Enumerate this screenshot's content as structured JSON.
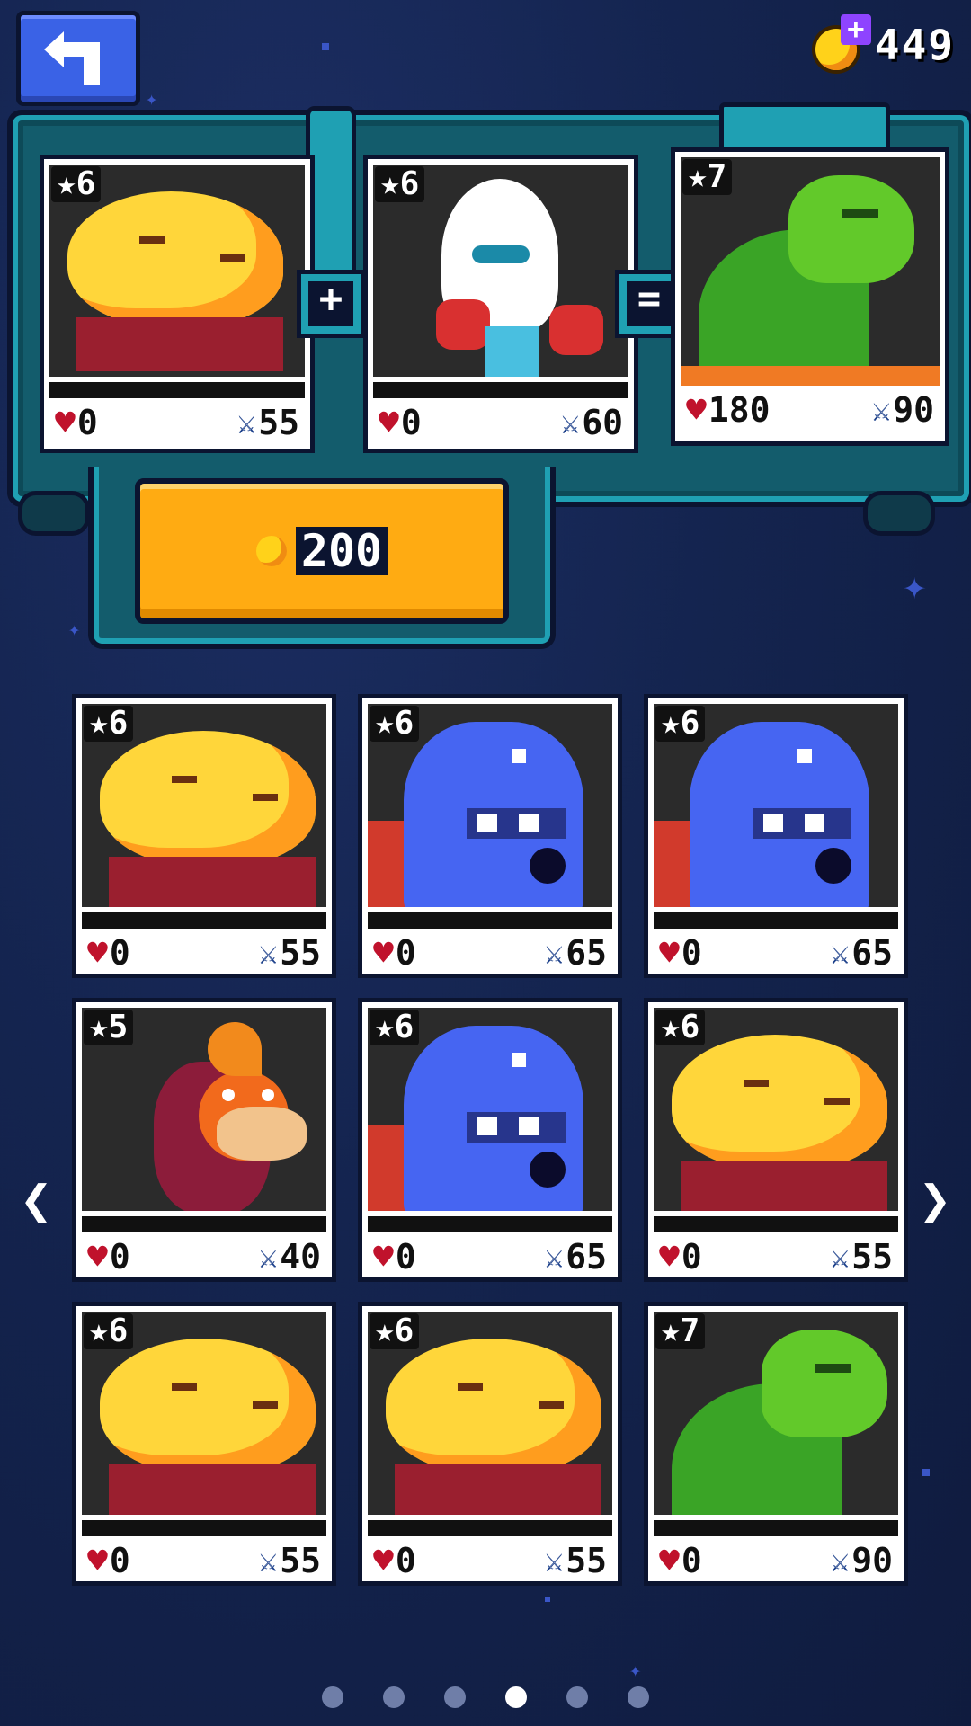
{
  "currency": {
    "value": "449",
    "icon": "gem-coin-plus-icon"
  },
  "fusion": {
    "slot1": {
      "stars": "★6",
      "hp": "0",
      "atk": "55",
      "creature": "sun-crab"
    },
    "slot2": {
      "stars": "★6",
      "hp": "0",
      "atk": "60",
      "creature": "boxer-ghost"
    },
    "result": {
      "stars": "★7",
      "hp": "180",
      "atk": "90",
      "creature": "green-dragon"
    },
    "plus_sign": "+",
    "equals_sign": "=",
    "cost": "200"
  },
  "grid": [
    {
      "stars": "★6",
      "hp": "0",
      "atk": "55",
      "creature": "sun-crab"
    },
    {
      "stars": "★6",
      "hp": "0",
      "atk": "65",
      "creature": "blue-beast"
    },
    {
      "stars": "★6",
      "hp": "0",
      "atk": "65",
      "creature": "blue-beast"
    },
    {
      "stars": "★5",
      "hp": "0",
      "atk": "40",
      "creature": "fire-duck"
    },
    {
      "stars": "★6",
      "hp": "0",
      "atk": "65",
      "creature": "blue-beast"
    },
    {
      "stars": "★6",
      "hp": "0",
      "atk": "55",
      "creature": "sun-crab"
    },
    {
      "stars": "★6",
      "hp": "0",
      "atk": "55",
      "creature": "sun-crab"
    },
    {
      "stars": "★6",
      "hp": "0",
      "atk": "55",
      "creature": "sun-crab"
    },
    {
      "stars": "★7",
      "hp": "0",
      "atk": "90",
      "creature": "green-dragon"
    }
  ],
  "nav": {
    "prev": "❮",
    "next": "❯"
  },
  "pager": {
    "count": 6,
    "active": 4
  },
  "colors": {
    "hp": "#c0122c",
    "atk": "#1b3f8a",
    "button": "#ffab12",
    "machine": "#1fa0b3"
  }
}
